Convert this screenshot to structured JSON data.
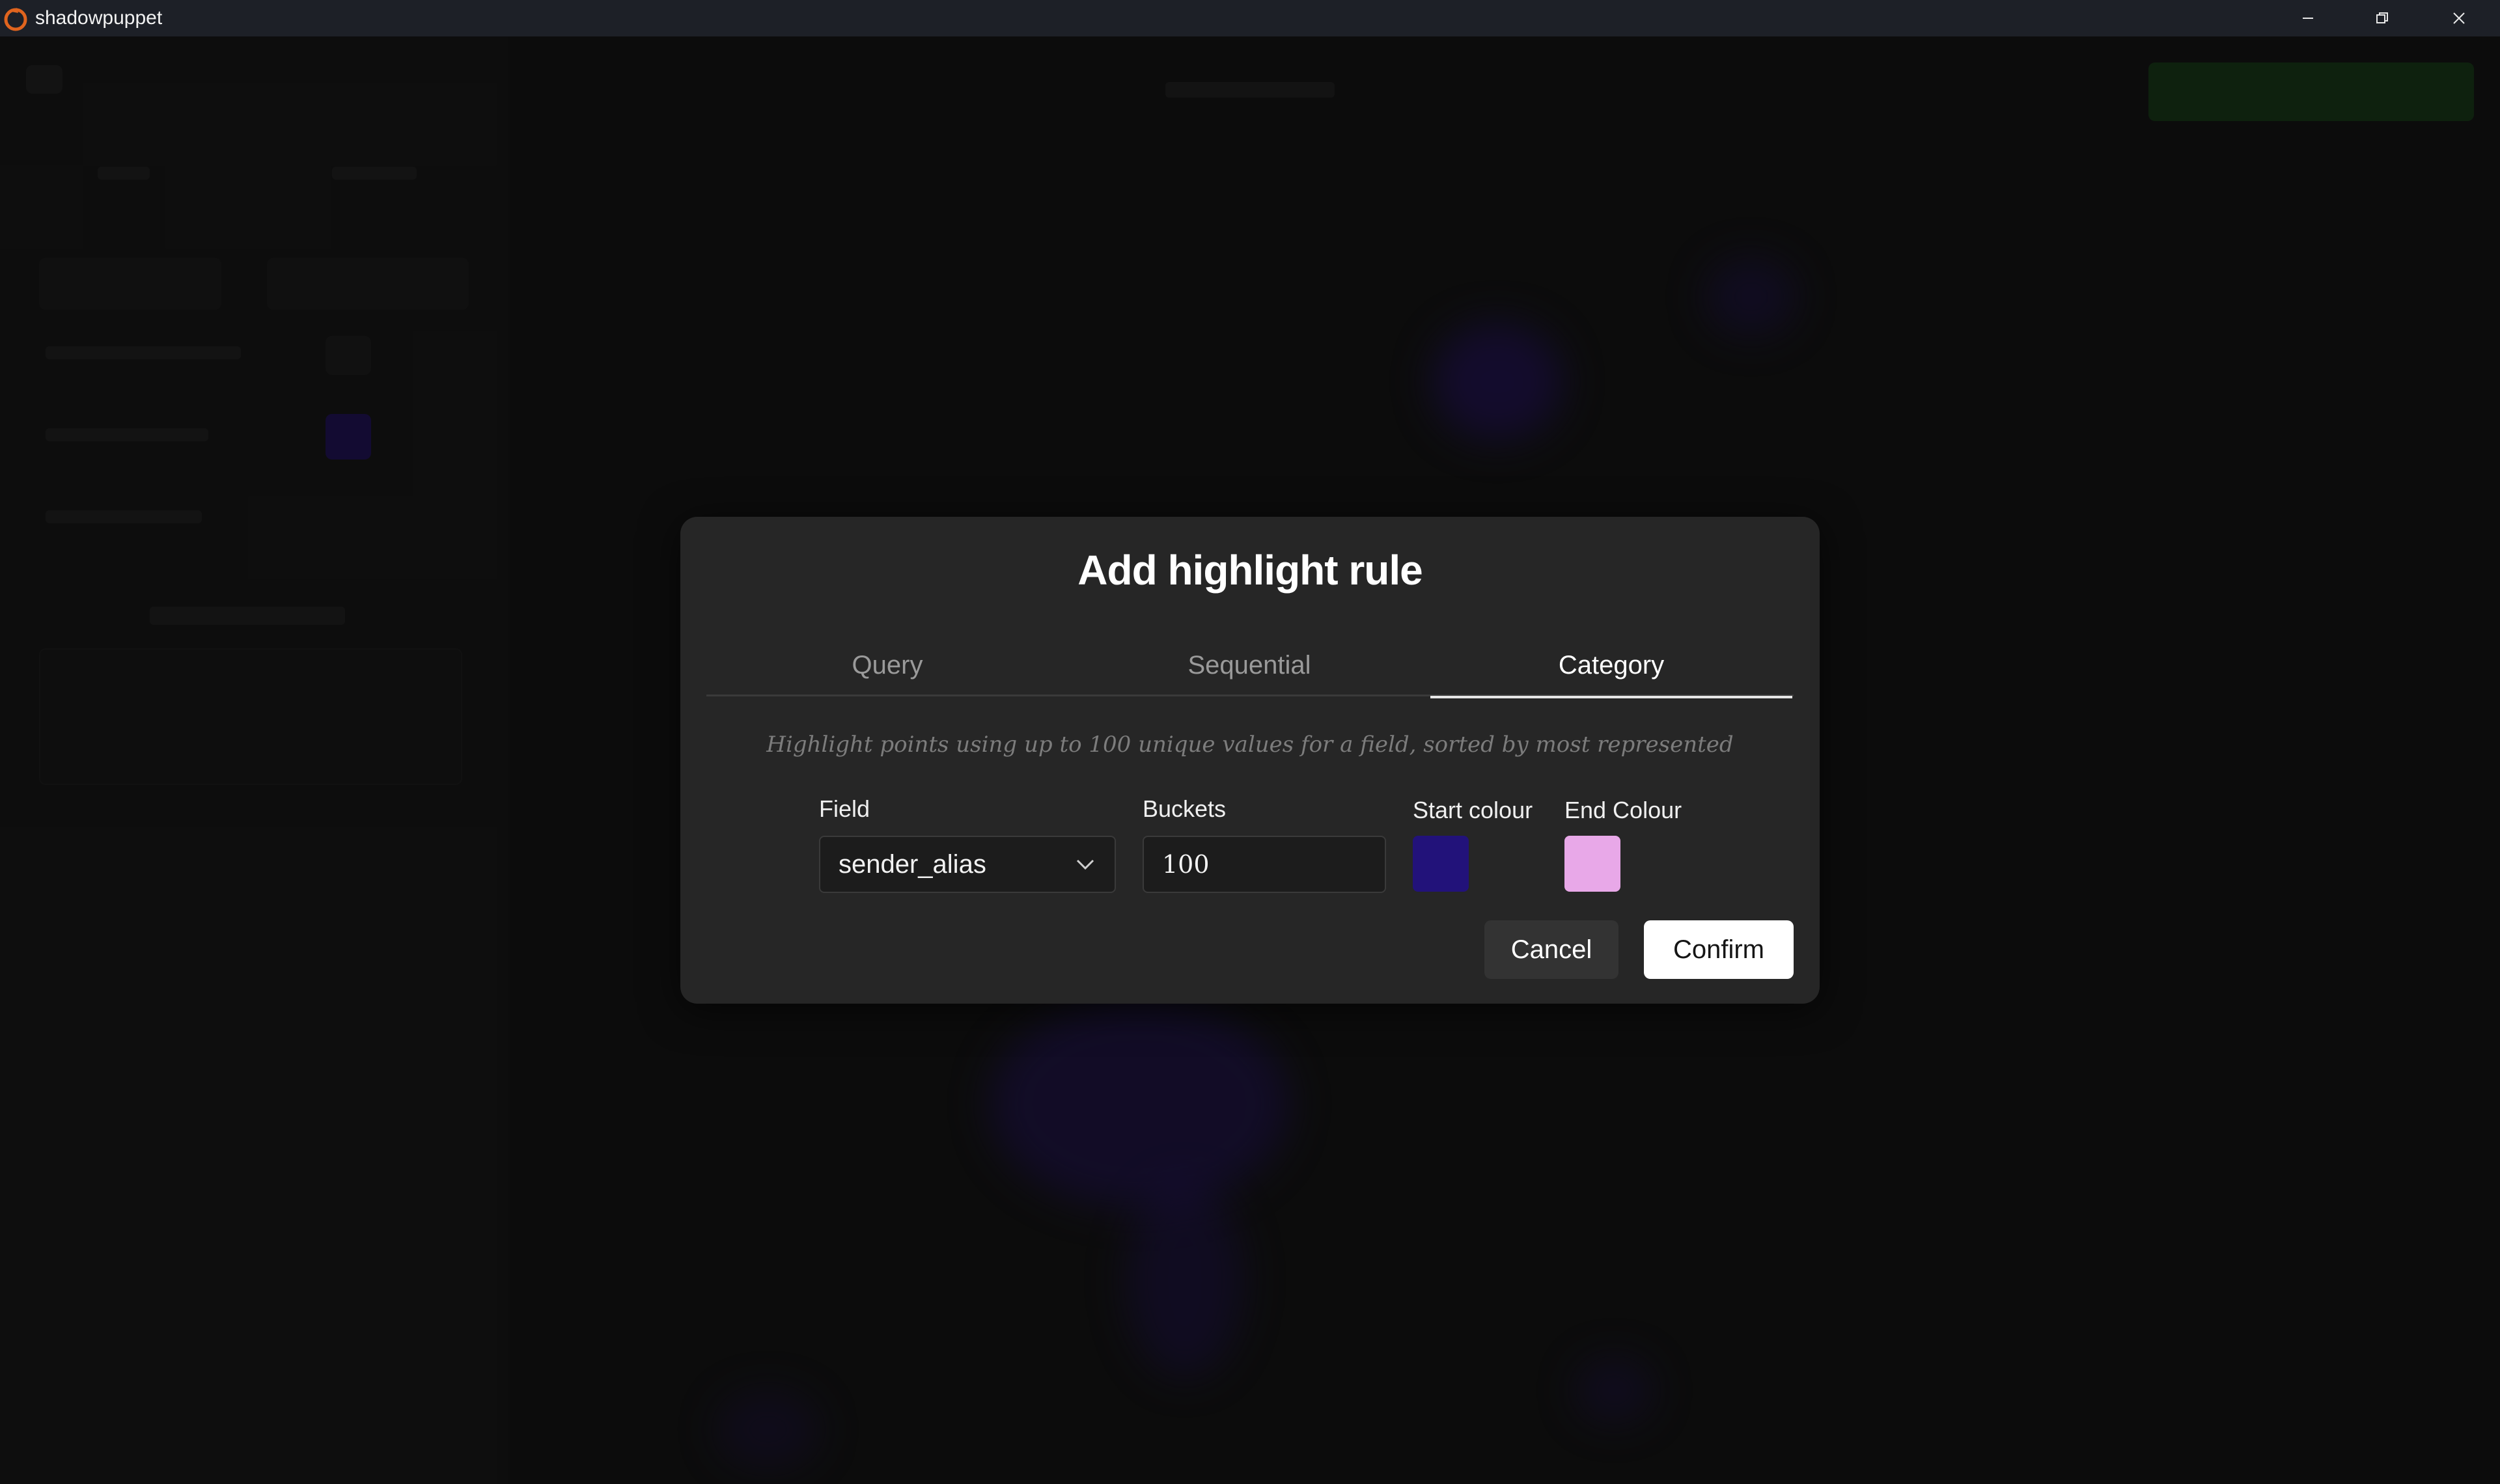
{
  "window": {
    "title": "shadowpuppet",
    "controls": {
      "minimize": "–",
      "maximize": "❐",
      "close": "✕"
    }
  },
  "modal": {
    "title": "Add highlight rule",
    "tabs": [
      {
        "label": "Query",
        "active": false
      },
      {
        "label": "Sequential",
        "active": false
      },
      {
        "label": "Category",
        "active": true
      }
    ],
    "description": "Highlight points using up to 100 unique values for a field, sorted by most represented",
    "field": {
      "label": "Field",
      "value": "sender_alias"
    },
    "buckets": {
      "label": "Buckets",
      "value": "100"
    },
    "start_colour": {
      "label": "Start colour",
      "color": "#22127a"
    },
    "end_colour": {
      "label": "End Colour",
      "color": "#e8a8e8"
    },
    "buttons": {
      "cancel": "Cancel",
      "confirm": "Confirm"
    }
  },
  "colors": {
    "titlebar": "#1d2027",
    "modal_bg": "#262626",
    "accent_green": "#3aa83a",
    "plot_points": "#3a1ea0"
  }
}
